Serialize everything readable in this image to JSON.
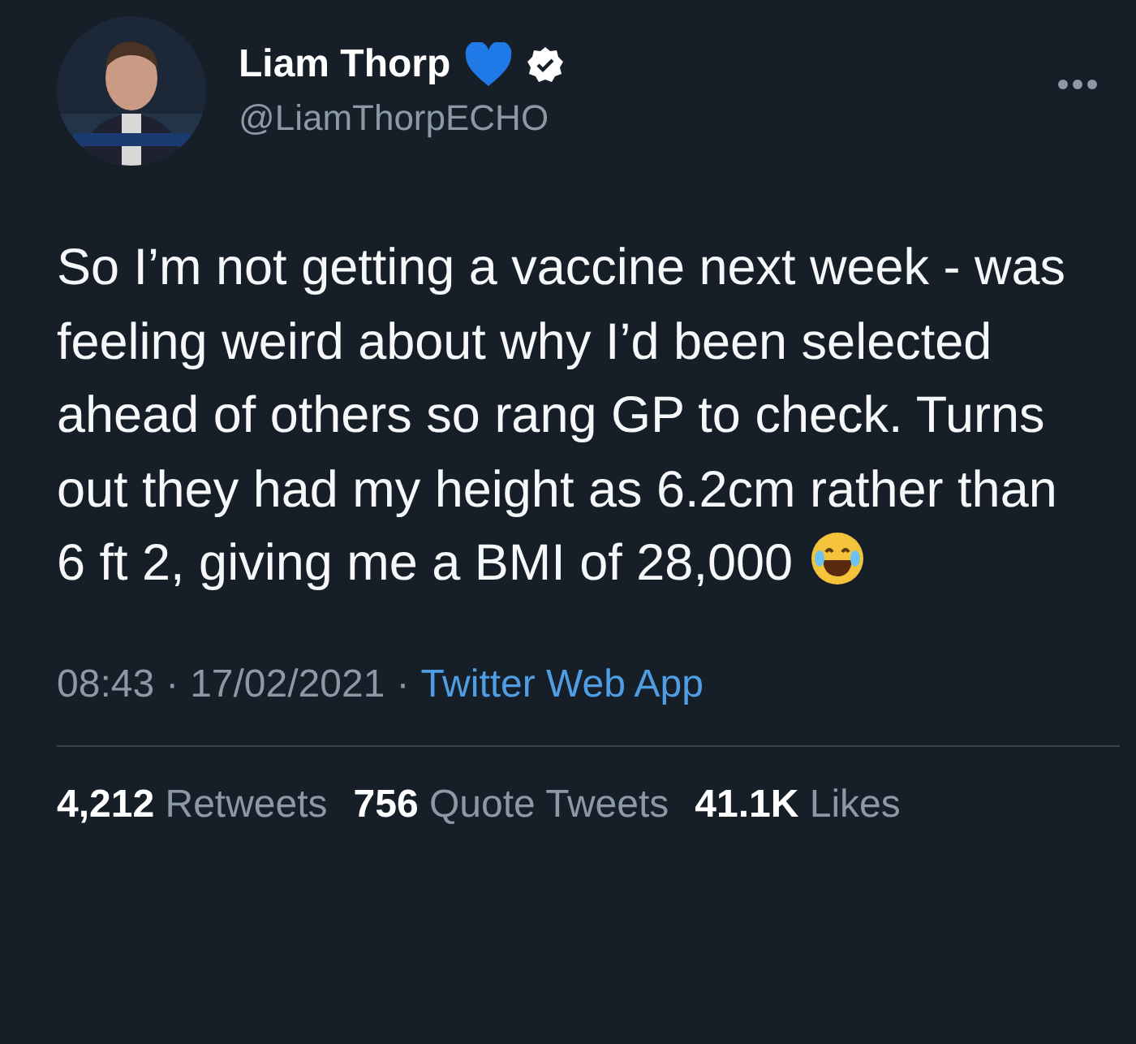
{
  "author": {
    "name": "Liam Thorp",
    "handle": "@LiamThorpECHO",
    "verified": true
  },
  "tweet": {
    "text": "So I’m not getting a vaccine next week - was feeling weird about why I’d been selected ahead of others so rang GP to check. Turns out they had my height as 6.2cm rather than 6 ft 2, giving me a BMI of 28,000"
  },
  "meta": {
    "time": "08:43",
    "separator_1": "·",
    "date": "17/02/2021",
    "separator_2": "·",
    "source": "Twitter Web App"
  },
  "stats": [
    {
      "count": "4,212",
      "label": "Retweets"
    },
    {
      "count": "756",
      "label": "Quote Tweets"
    },
    {
      "count": "41.1K",
      "label": "Likes"
    }
  ]
}
